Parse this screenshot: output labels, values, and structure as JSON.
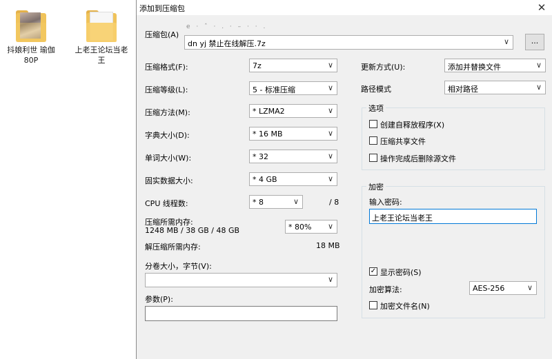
{
  "desktop": {
    "icons": [
      {
        "label": "抖娘利世 瑜伽\n80P"
      },
      {
        "label": "上老王论坛当老\n王"
      }
    ]
  },
  "dialog": {
    "title": "添加到压缩包",
    "close_glyph": "✕",
    "archive": {
      "label": "压缩包(A)",
      "value": "dn yj 禁止在线解压.7z",
      "browse_label": "...",
      "scribble": "e · ˆ · . · – · · ."
    },
    "format": {
      "label": "压缩格式(F):",
      "value": "7z"
    },
    "level": {
      "label": "压缩等级(L):",
      "value": "5 - 标准压缩"
    },
    "method": {
      "label": "压缩方法(M):",
      "value": "* LZMA2"
    },
    "dict": {
      "label": "字典大小(D):",
      "value": "* 16 MB"
    },
    "word": {
      "label": "单词大小(W):",
      "value": "* 32"
    },
    "solid": {
      "label": "固实数据大小:",
      "value": "* 4 GB"
    },
    "threads": {
      "label": "CPU 线程数:",
      "value": "* 8",
      "max": "/ 8"
    },
    "mem_compress": {
      "label": "压缩所需内存:",
      "detail": "1248 MB / 38 GB / 48 GB",
      "value": "* 80%"
    },
    "mem_decompress": {
      "label": "解压缩所需内存:",
      "value": "18 MB"
    },
    "volume": {
      "label": "分卷大小，字节(V):",
      "value": ""
    },
    "params": {
      "label": "参数(P):",
      "value": ""
    },
    "update": {
      "label": "更新方式(U):",
      "value": "添加并替换文件"
    },
    "path": {
      "label": "路径模式",
      "value": "相对路径"
    },
    "options": {
      "title": "选项",
      "items": [
        {
          "label": "创建自释放程序(X)",
          "checked": false
        },
        {
          "label": "压缩共享文件",
          "checked": false
        },
        {
          "label": "操作完成后删除源文件",
          "checked": false
        }
      ]
    },
    "encryption": {
      "title": "加密",
      "password_label": "输入密码:",
      "password_value": "上老王论坛当老王",
      "show_password": {
        "label": "显示密码(S)",
        "checked": true
      },
      "algo_label": "加密算法:",
      "algo_value": "AES-256",
      "encrypt_names": {
        "label": "加密文件名(N)",
        "checked": false
      }
    },
    "arrow": "∨",
    "check_glyph": "✓"
  }
}
